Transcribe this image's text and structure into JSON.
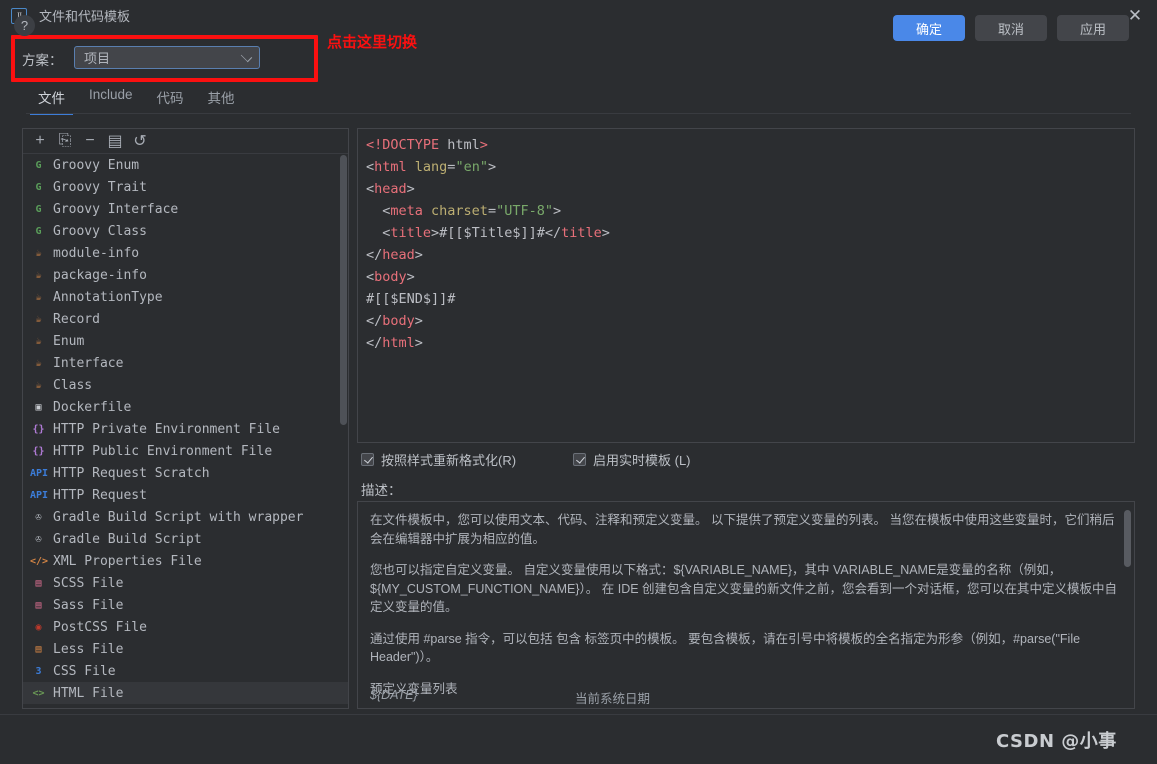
{
  "window": {
    "title": "文件和代码模板",
    "logo_text": "IJ",
    "close_icon": "close-icon"
  },
  "scheme": {
    "label": "方案：",
    "value": "项目",
    "hint": "点击这里切换",
    "hint_color": "#fb1010",
    "highlight_color": "#fb1010"
  },
  "tabs": [
    {
      "label": "文件",
      "active": true
    },
    {
      "label": "Include",
      "active": false
    },
    {
      "label": "代码",
      "active": false
    },
    {
      "label": "其他",
      "active": false
    }
  ],
  "list_toolbar": [
    {
      "name": "add-icon",
      "glyph": "+"
    },
    {
      "name": "copy-icon",
      "glyph": "⎘"
    },
    {
      "name": "remove-icon",
      "glyph": "−"
    },
    {
      "name": "duplicate-icon",
      "glyph": "▤"
    },
    {
      "name": "reset-icon",
      "glyph": "↺"
    }
  ],
  "file_list": [
    {
      "label": "HTML File",
      "icon": "<>",
      "color": "#6a9955",
      "selected": true
    },
    {
      "label": "CSS File",
      "icon": "3",
      "color": "#3c7dd9",
      "selected": false
    },
    {
      "label": "Less File",
      "icon": "▤",
      "color": "#d28445",
      "selected": false
    },
    {
      "label": "PostCSS File",
      "icon": "◉",
      "color": "#c0392b",
      "selected": false
    },
    {
      "label": "Sass File",
      "icon": "▤",
      "color": "#cf6a8a",
      "selected": false
    },
    {
      "label": "SCSS File",
      "icon": "▤",
      "color": "#cf6a8a",
      "selected": false
    },
    {
      "label": "XML Properties File",
      "icon": "</>",
      "color": "#d28445",
      "selected": false
    },
    {
      "label": "Gradle Build Script",
      "icon": "✇",
      "color": "#b4b8bf",
      "selected": false
    },
    {
      "label": "Gradle Build Script with wrapper",
      "icon": "✇",
      "color": "#b4b8bf",
      "selected": false
    },
    {
      "label": "HTTP Request",
      "icon": "API",
      "color": "#3c7dd9",
      "selected": false
    },
    {
      "label": "HTTP Request Scratch",
      "icon": "API",
      "color": "#3c7dd9",
      "selected": false
    },
    {
      "label": "HTTP Public Environment File",
      "icon": "{}",
      "color": "#b07bd6",
      "selected": false
    },
    {
      "label": "HTTP Private Environment File",
      "icon": "{}",
      "color": "#b07bd6",
      "selected": false
    },
    {
      "label": "Dockerfile",
      "icon": "▣",
      "color": "#c9ccd1",
      "selected": false
    },
    {
      "label": "Class",
      "icon": "☕",
      "color": "#d28445",
      "selected": false
    },
    {
      "label": "Interface",
      "icon": "☕",
      "color": "#d28445",
      "selected": false
    },
    {
      "label": "Enum",
      "icon": "☕",
      "color": "#d28445",
      "selected": false
    },
    {
      "label": "Record",
      "icon": "☕",
      "color": "#d28445",
      "selected": false
    },
    {
      "label": "AnnotationType",
      "icon": "☕",
      "color": "#d28445",
      "selected": false
    },
    {
      "label": "package-info",
      "icon": "☕",
      "color": "#d28445",
      "selected": false
    },
    {
      "label": "module-info",
      "icon": "☕",
      "color": "#d28445",
      "selected": false
    },
    {
      "label": "Groovy Class",
      "icon": "G",
      "color": "#5a9e5a",
      "selected": false
    },
    {
      "label": "Groovy Interface",
      "icon": "G",
      "color": "#5a9e5a",
      "selected": false
    },
    {
      "label": "Groovy Trait",
      "icon": "G",
      "color": "#5a9e5a",
      "selected": false
    },
    {
      "label": "Groovy Enum",
      "icon": "G",
      "color": "#5a9e5a",
      "selected": false
    }
  ],
  "editor": {
    "lines": [
      [
        {
          "t": "<!DOCTYPE ",
          "c": "t-doctype"
        },
        {
          "t": "html",
          "c": "t-plain"
        },
        {
          "t": ">",
          "c": "t-doctype"
        }
      ],
      [
        {
          "t": "<",
          "c": "t-punct"
        },
        {
          "t": "html",
          "c": "t-tag"
        },
        {
          "t": " lang",
          "c": "t-attr"
        },
        {
          "t": "=",
          "c": "t-punct"
        },
        {
          "t": "\"en\"",
          "c": "t-str"
        },
        {
          "t": ">",
          "c": "t-punct"
        }
      ],
      [
        {
          "t": "<",
          "c": "t-punct"
        },
        {
          "t": "head",
          "c": "t-tag"
        },
        {
          "t": ">",
          "c": "t-punct"
        }
      ],
      [
        {
          "t": "  <",
          "c": "t-punct"
        },
        {
          "t": "meta",
          "c": "t-tag"
        },
        {
          "t": " charset",
          "c": "t-attr"
        },
        {
          "t": "=",
          "c": "t-punct"
        },
        {
          "t": "\"UTF-8\"",
          "c": "t-str"
        },
        {
          "t": ">",
          "c": "t-punct"
        }
      ],
      [
        {
          "t": "  <",
          "c": "t-punct"
        },
        {
          "t": "title",
          "c": "t-tag"
        },
        {
          "t": ">",
          "c": "t-punct"
        },
        {
          "t": "#[[$Title$]]#",
          "c": "t-plain"
        },
        {
          "t": "</",
          "c": "t-punct"
        },
        {
          "t": "title",
          "c": "t-tag"
        },
        {
          "t": ">",
          "c": "t-punct"
        }
      ],
      [
        {
          "t": "</",
          "c": "t-punct"
        },
        {
          "t": "head",
          "c": "t-tag"
        },
        {
          "t": ">",
          "c": "t-punct"
        }
      ],
      [
        {
          "t": "<",
          "c": "t-punct"
        },
        {
          "t": "body",
          "c": "t-tag"
        },
        {
          "t": ">",
          "c": "t-punct"
        }
      ],
      [
        {
          "t": "#[[$END$]]#",
          "c": "t-plain"
        }
      ],
      [
        {
          "t": "</",
          "c": "t-punct"
        },
        {
          "t": "body",
          "c": "t-tag"
        },
        {
          "t": ">",
          "c": "t-punct"
        }
      ],
      [
        {
          "t": "</",
          "c": "t-punct"
        },
        {
          "t": "html",
          "c": "t-tag"
        },
        {
          "t": ">",
          "c": "t-punct"
        }
      ]
    ]
  },
  "options": {
    "reformat": {
      "label": "按照样式重新格式化(R)",
      "checked": true
    },
    "live_template": {
      "label": "启用实时模板 (L)",
      "checked": true
    }
  },
  "description": {
    "label": "描述：",
    "paragraphs": [
      "在文件模板中，您可以使用文本、代码、注释和预定义变量。 以下提供了预定义变量的列表。 当您在模板中使用这些变量时，它们稍后会在编辑器中扩展为相应的值。",
      "您也可以指定自定义变量。 自定义变量使用以下格式：${VARIABLE_NAME}，其中 VARIABLE_NAME是变量的名称（例如，${MY_CUSTOM_FUNCTION_NAME}）。 在 IDE 创建包含自定义变量的新文件之前，您会看到一个对话框，您可以在其中定义模板中自定义变量的值。",
      "通过使用 #parse 指令，可以包括 包含 标签页中的模板。 要包含模板，请在引号中将模板的全名指定为形参（例如，#parse(\"File Header\")）。",
      "预定义变量列表"
    ],
    "table_row": {
      "variable": "${DATE}",
      "meaning": "当前系统日期"
    }
  },
  "footer": {
    "help_label": "?",
    "ok_label": "确定",
    "cancel_label": "取消",
    "apply_label": "应用",
    "watermark": "CSDN @小事"
  }
}
